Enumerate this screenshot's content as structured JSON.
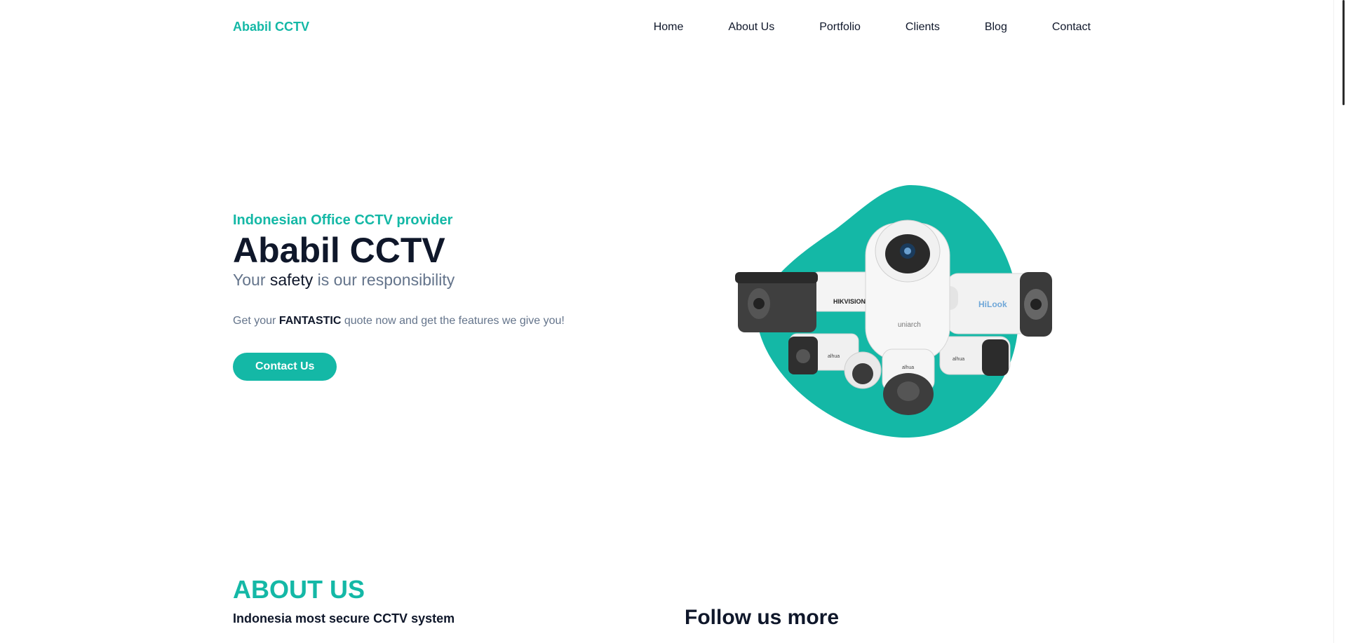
{
  "brand": "Ababil CCTV",
  "nav": [
    "Home",
    "About Us",
    "Portfolio",
    "Clients",
    "Blog",
    "Contact"
  ],
  "hero": {
    "subtitle": "Indonesian Office CCTV provider",
    "title": "Ababil CCTV",
    "tagline_pre": "Your",
    "tagline_em": "safety",
    "tagline_post": "is our responsibility",
    "desc_pre": "Get your",
    "desc_bold": "FANTASTIC",
    "desc_post": "quote now and get the features we give you!",
    "cta": "Contact Us"
  },
  "camera_brands": [
    "HIKVISION",
    "uniarch",
    "HiLook",
    "alhua",
    "alhua"
  ],
  "about": {
    "title": "ABOUT US",
    "subtitle": "Indonesia most secure CCTV system"
  },
  "follow": "Follow us more",
  "colors": {
    "accent": "#14b8a6",
    "text": "#0f172a",
    "muted": "#64748b"
  }
}
